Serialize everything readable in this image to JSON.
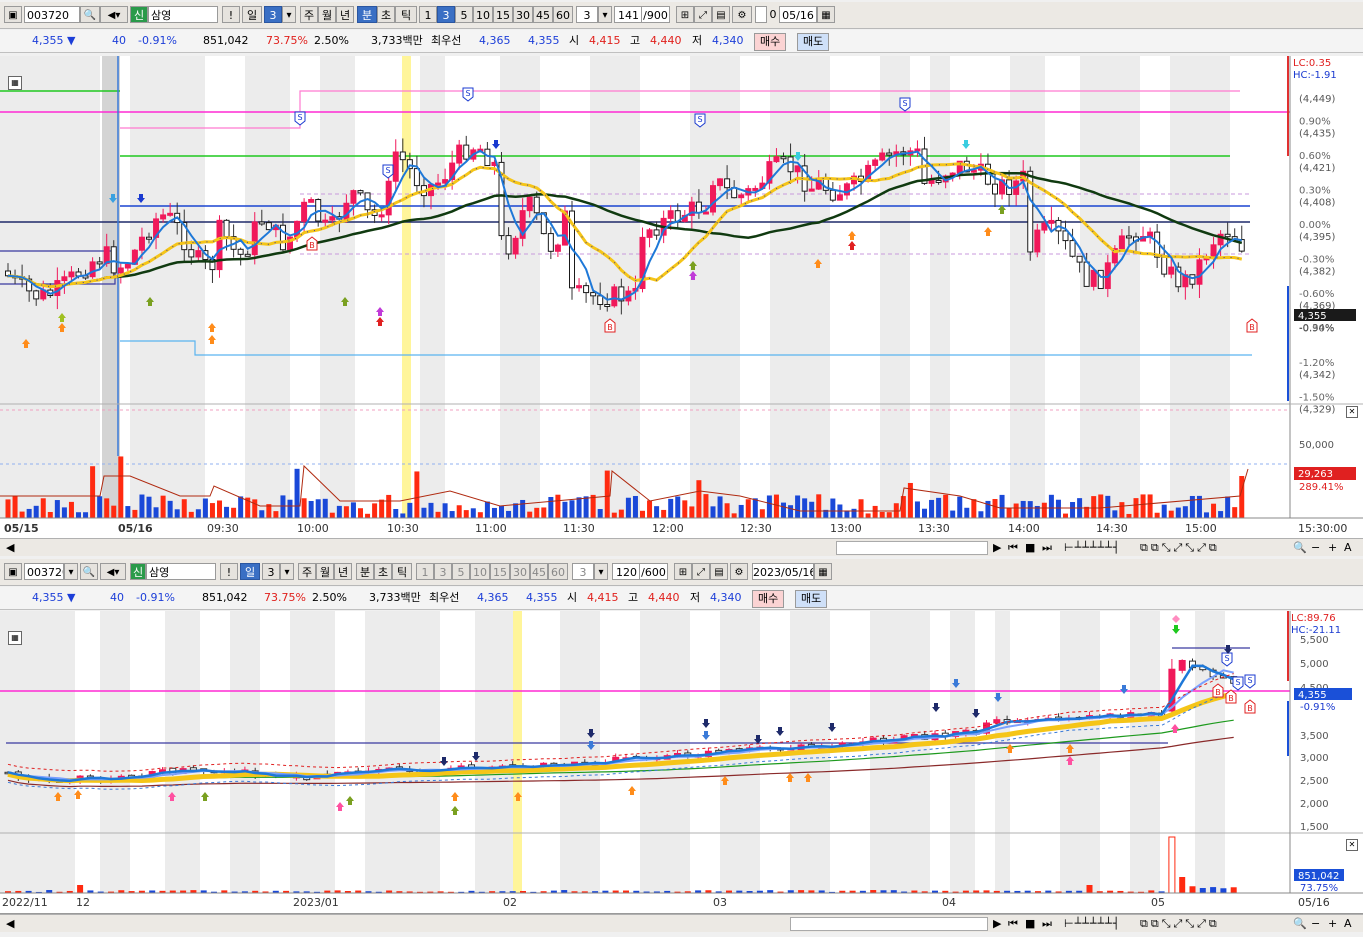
{
  "top": {
    "toolbar": {
      "code": "003720",
      "flag": "신",
      "name": "삼영",
      "period": "3",
      "tabs": [
        "일",
        "3",
        "주",
        "월",
        "년",
        "분",
        "초",
        "틱"
      ],
      "intervals": [
        "1",
        "3",
        "5",
        "10",
        "15",
        "30",
        "45",
        "60"
      ],
      "custom": "3",
      "count": "141",
      "max": "/900",
      "checkbox_label": "0",
      "date": "05/16"
    },
    "info": {
      "price": "4,355 ▼",
      "change": "40",
      "pct": "-0.91%",
      "volume": "851,042",
      "ratio": "73.75%",
      "turnover": "2.50%",
      "amount": "3,733백만",
      "best_label": "최우선",
      "ask": "4,365",
      "bid": "4,355",
      "open_label": "시",
      "open": "4,415",
      "high_label": "고",
      "high": "4,440",
      "low_label": "저",
      "low": "4,340",
      "buy": "매수",
      "sell": "매도"
    },
    "right_axis": {
      "lc": "LC:0.35",
      "hc": "HC:-1.91",
      "ticks": [
        {
          "pct": "",
          "price": "(4,449)"
        },
        {
          "pct": "0.90%",
          "price": "(4,435)"
        },
        {
          "pct": "0.60%",
          "price": "(4,421)"
        },
        {
          "pct": "0.30%",
          "price": "(4,408)"
        },
        {
          "pct": "0.00%",
          "price": "(4,395)"
        },
        {
          "pct": "-0.30%",
          "price": "(4,382)"
        },
        {
          "pct": "-0.60%",
          "price": "(4,369)"
        },
        {
          "pct": "-0.90%",
          "price": ""
        },
        {
          "pct": "-1.20%",
          "price": "(4,342)"
        },
        {
          "pct": "-1.50%",
          "price": "(4,329)"
        }
      ],
      "current": "4,355",
      "current_pct": "-0.34%",
      "volume_tick": "50,000",
      "volume_current": "29,263",
      "volume_pct": "289.41%"
    },
    "time_axis": [
      "05/15",
      "05/16",
      "09:30",
      "10:00",
      "10:30",
      "11:00",
      "11:30",
      "12:00",
      "12:30",
      "13:00",
      "13:30",
      "14:00",
      "14:30",
      "15:00",
      "15:30:00"
    ]
  },
  "bottom": {
    "toolbar": {
      "code": "003720",
      "flag": "신",
      "name": "삼영",
      "period": "3",
      "tabs": [
        "일",
        "3",
        "주",
        "월",
        "년",
        "분",
        "초",
        "틱"
      ],
      "intervals": [
        "1",
        "3",
        "5",
        "10",
        "15",
        "30",
        "45",
        "60"
      ],
      "custom": "3",
      "count": "120",
      "max": "/600",
      "date": "2023/05/16"
    },
    "info": {
      "price": "4,355 ▼",
      "change": "40",
      "pct": "-0.91%",
      "volume": "851,042",
      "ratio": "73.75%",
      "turnover": "2.50%",
      "amount": "3,733백만",
      "best_label": "최우선",
      "ask": "4,365",
      "bid": "4,355",
      "open_label": "시",
      "open": "4,415",
      "high_label": "고",
      "high": "4,440",
      "low_label": "저",
      "low": "4,340",
      "buy": "매수",
      "sell": "매도"
    },
    "right_axis": {
      "lc": "LC:89.76",
      "hc": "HC:-21.11",
      "ticks": [
        "5,500",
        "5,000",
        "4,500",
        "3,500",
        "3,000",
        "2,500",
        "2,000",
        "1,500"
      ],
      "current": "4,355",
      "current_pct": "-0.91%",
      "volume_current": "851,042",
      "volume_pct": "73.75%"
    },
    "time_axis": [
      "2022/11",
      "12",
      "2023/01",
      "02",
      "03",
      "04",
      "05",
      "05/16"
    ]
  },
  "colors": {
    "up": "#f0195a",
    "down": "#1a50d8",
    "ma_gold": "#f5c518",
    "ma_blue": "#1e78d8",
    "magenta": "#ff2ad4",
    "green": "#1ec81e"
  }
}
